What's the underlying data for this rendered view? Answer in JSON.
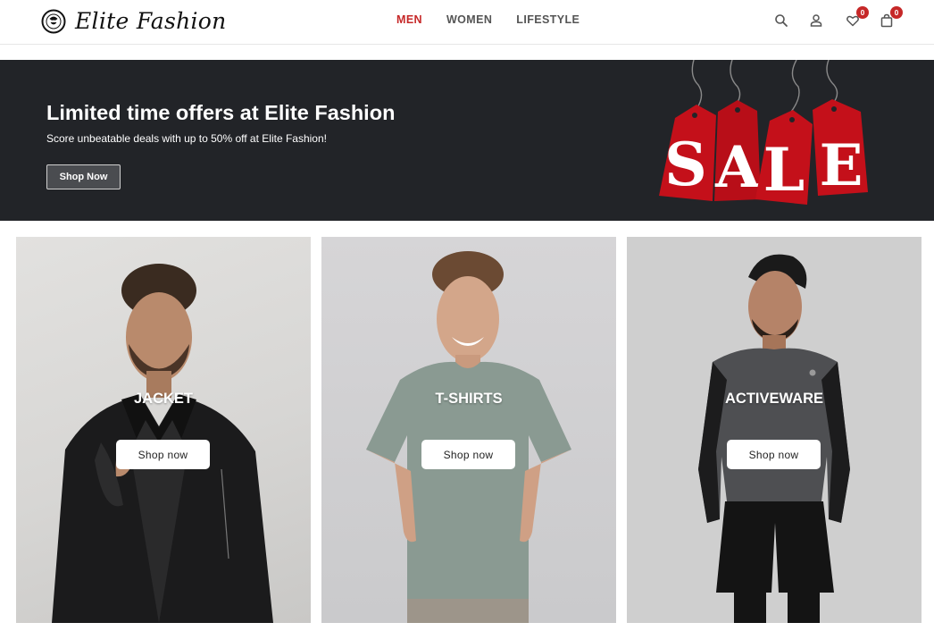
{
  "brand": {
    "name": "Elite Fashion"
  },
  "nav": [
    {
      "label": "MEN",
      "active": true
    },
    {
      "label": "WOMEN",
      "active": false
    },
    {
      "label": "LIFESTYLE",
      "active": false
    }
  ],
  "header_icons": {
    "search": "search-icon",
    "account": "user-icon",
    "wishlist": "heart-icon",
    "wishlist_count": "0",
    "cart": "shopping-bag-icon",
    "cart_count": "0"
  },
  "banner": {
    "title": "Limited time offers at Elite Fashion",
    "subtitle": "Score unbeatable deals with up to 50% off at Elite Fashion!",
    "button": "Shop Now",
    "sale_letters": [
      "S",
      "A",
      "L",
      "E"
    ]
  },
  "categories": [
    {
      "title": "JACKET",
      "button": "Shop now"
    },
    {
      "title": "T-SHIRTS",
      "button": "Shop now"
    },
    {
      "title": "ACTIVEWARE",
      "button": "Shop now"
    }
  ],
  "colors": {
    "accent": "#c62828",
    "banner_bg": "#222428",
    "sale_tag": "#c4101a"
  }
}
